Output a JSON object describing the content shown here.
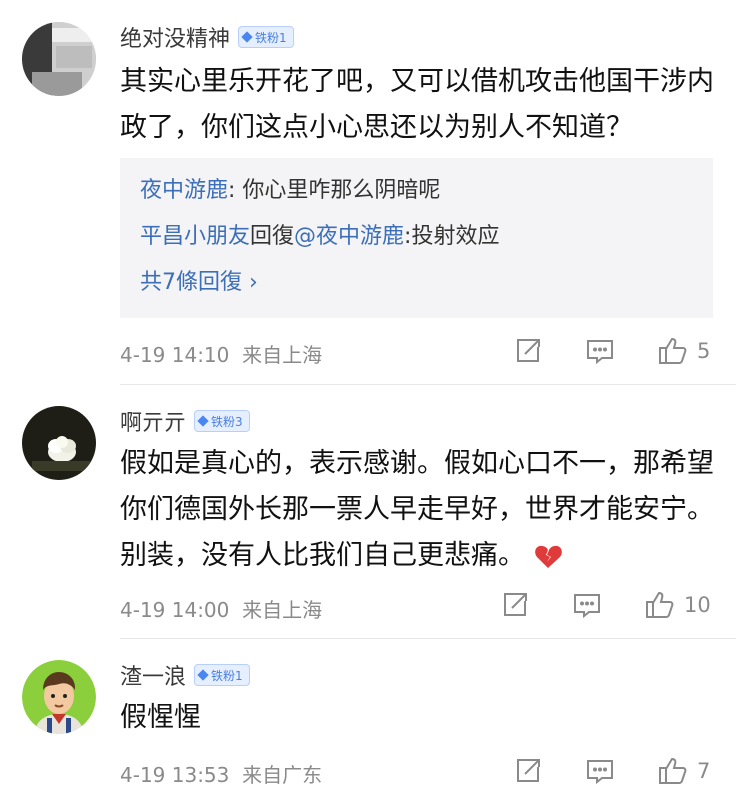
{
  "comments": [
    {
      "username": "绝对没精神",
      "badge": "铁粉1",
      "text": "其实心里乐开花了吧，又可以借机攻击他国干涉内政了，你们这点小心思还以为别人不知道？",
      "replies": {
        "reply1_user": "夜中游鹿",
        "reply1_text": ": 你心里咋那么阴暗呢",
        "reply2_user": "平昌小朋友",
        "reply2_mid": "回復",
        "reply2_at": "@夜中游鹿",
        "reply2_text": ":投射效应",
        "more": "共7條回復 ›"
      },
      "time": "4-19 14:10",
      "location": "来自上海",
      "likes": "5"
    },
    {
      "username": "啊亓亓",
      "badge": "铁粉3",
      "text": "假如是真心的，表示感谢。假如心口不一，那希望你们德国外长那一票人早走早好，世界才能安宁。别装，没有人比我们自己更悲痛。",
      "emoji": "broken-heart-icon",
      "time": "4-19 14:00",
      "location": "来自上海",
      "likes": "10"
    },
    {
      "username": "渣一浪",
      "badge": "铁粉1",
      "text": "假惺惺",
      "time": "4-19 13:53",
      "location": "来自广东",
      "likes": "7"
    }
  ],
  "colors": {
    "link": "#3d6fb8",
    "meta": "#8a8a8a",
    "badge_bg": "#e6efff",
    "reply_bg": "#f4f4f6"
  },
  "icons": [
    "repost-icon",
    "comment-icon",
    "thumbs-up-icon"
  ]
}
